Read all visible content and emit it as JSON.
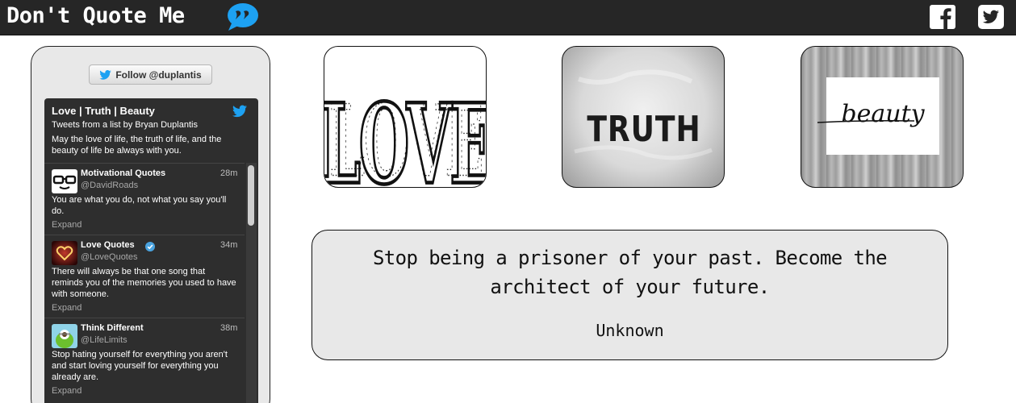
{
  "header": {
    "title": "Don't Quote Me",
    "logo_icon": "speech-bubble-quote-icon",
    "social": [
      {
        "name": "facebook",
        "icon": "facebook-icon"
      },
      {
        "name": "twitter",
        "icon": "twitter-icon"
      }
    ]
  },
  "sidebar": {
    "follow_label": "Follow @duplantis",
    "widget": {
      "title": "Love | Truth | Beauty",
      "subtitle": "Tweets from a list by Bryan Duplantis",
      "description": "May the love of life, the truth of life, and the beauty of life be always with you."
    },
    "tweets": [
      {
        "name": "Motivational Quotes",
        "handle": "@DavidRoads",
        "time": "28m",
        "text": "You are what you do, not what you say you'll do.",
        "expand": "Expand"
      },
      {
        "name": "Love Quotes",
        "handle": "@LoveQuotes",
        "time": "34m",
        "text": "There will always be that one song that reminds you of the memories you used to have with someone.",
        "expand": "Expand",
        "verified": true
      },
      {
        "name": "Think Different",
        "handle": "@LifeLimits",
        "time": "38m",
        "text": "Stop hating yourself for everything you aren't and start loving yourself for everything you already are.",
        "expand": "Expand"
      }
    ]
  },
  "cards": [
    {
      "word": "LOVE"
    },
    {
      "word": "TRUTH"
    },
    {
      "word": "beauty"
    }
  ],
  "quote": {
    "text": "Stop being a prisoner of your past. Become the architect of your future.",
    "author": "Unknown"
  },
  "colors": {
    "header_bg": "#262626",
    "accent_blue": "#1da1f2",
    "panel_bg": "#e8e8e8",
    "widget_bg": "#2e2e2e"
  }
}
